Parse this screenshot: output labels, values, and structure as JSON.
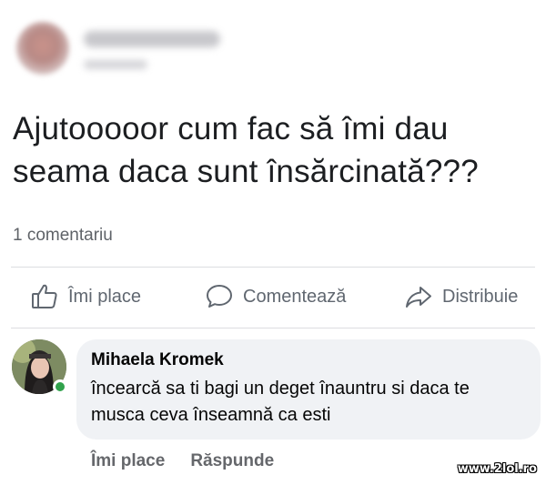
{
  "post": {
    "text": "Ajutooooor cum fac să îmi dau seama daca sunt însărcinată???",
    "comment_count": "1 comentariu"
  },
  "actions": {
    "like_label": "Îmi place",
    "comment_label": "Comentează",
    "share_label": "Distribuie"
  },
  "comment": {
    "author": "Mihaela Kromek",
    "text": "încearcă sa ti bagi un deget înauntru si daca te musca ceva înseamnă ca esti",
    "like_label": "Îmi place",
    "reply_label": "Răspunde"
  },
  "watermark": "www.2lol.ro",
  "icons": {
    "like": "thumbs-up-icon",
    "comment": "speech-bubble-icon",
    "share": "share-arrow-icon"
  },
  "colors": {
    "text_primary": "#1c1e21",
    "text_secondary": "#606770",
    "bubble_bg": "#f0f2f5",
    "online": "#31a24c"
  }
}
